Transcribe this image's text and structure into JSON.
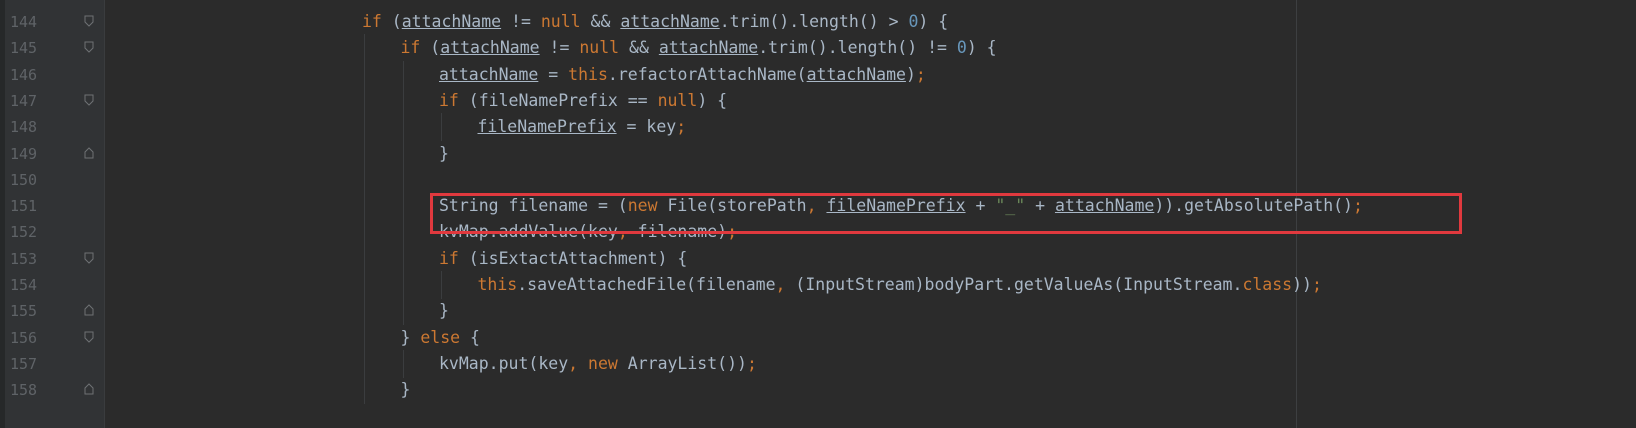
{
  "editor": {
    "lines": [
      {
        "num": "144",
        "indent": 0,
        "tokens": [
          {
            "t": "if",
            "c": "kw"
          },
          {
            "t": " ("
          },
          {
            "t": "attachName",
            "c": "ul"
          },
          {
            "t": " != "
          },
          {
            "t": "null",
            "c": "kw"
          },
          {
            "t": " && "
          },
          {
            "t": "attachName",
            "c": "ul"
          },
          {
            "t": ".trim().length() > "
          },
          {
            "t": "0",
            "c": "num"
          },
          {
            "t": ") {"
          }
        ]
      },
      {
        "num": "145",
        "indent": 1,
        "tokens": [
          {
            "t": "if",
            "c": "kw"
          },
          {
            "t": " ("
          },
          {
            "t": "attachName",
            "c": "ul"
          },
          {
            "t": " != "
          },
          {
            "t": "null",
            "c": "kw"
          },
          {
            "t": " && "
          },
          {
            "t": "attachName",
            "c": "ul"
          },
          {
            "t": ".trim().length() != "
          },
          {
            "t": "0",
            "c": "num"
          },
          {
            "t": ") {"
          }
        ]
      },
      {
        "num": "146",
        "indent": 2,
        "tokens": [
          {
            "t": "attachName",
            "c": "ul"
          },
          {
            "t": " = "
          },
          {
            "t": "this",
            "c": "kw"
          },
          {
            "t": ".refactorAttachName("
          },
          {
            "t": "attachName",
            "c": "ul"
          },
          {
            "t": ")"
          },
          {
            "t": ";",
            "c": "kw"
          }
        ]
      },
      {
        "num": "147",
        "indent": 2,
        "tokens": [
          {
            "t": "if",
            "c": "kw"
          },
          {
            "t": " (fileNamePrefix == "
          },
          {
            "t": "null",
            "c": "kw"
          },
          {
            "t": ") {"
          }
        ]
      },
      {
        "num": "148",
        "indent": 3,
        "tokens": [
          {
            "t": "fileNamePrefix",
            "c": "ul"
          },
          {
            "t": " = key"
          },
          {
            "t": ";",
            "c": "kw"
          }
        ]
      },
      {
        "num": "149",
        "indent": 2,
        "tokens": [
          {
            "t": "}"
          }
        ]
      },
      {
        "num": "150",
        "indent": 2,
        "tokens": []
      },
      {
        "num": "151",
        "indent": 2,
        "tokens": [
          {
            "t": "String filename = ("
          },
          {
            "t": "new",
            "c": "kw"
          },
          {
            "t": " File(storePath"
          },
          {
            "t": ",",
            "c": "kw"
          },
          {
            "t": " "
          },
          {
            "t": "fileNamePrefix",
            "c": "ul"
          },
          {
            "t": " + "
          },
          {
            "t": "\"_\"",
            "c": "str"
          },
          {
            "t": " + "
          },
          {
            "t": "attachName",
            "c": "ul"
          },
          {
            "t": ")).getAbsolutePath()"
          },
          {
            "t": ";",
            "c": "kw"
          }
        ]
      },
      {
        "num": "152",
        "indent": 2,
        "tokens": [
          {
            "t": "kvMap.addValue(key"
          },
          {
            "t": ",",
            "c": "kw"
          },
          {
            "t": " filename)"
          },
          {
            "t": ";",
            "c": "kw"
          }
        ]
      },
      {
        "num": "153",
        "indent": 2,
        "tokens": [
          {
            "t": "if",
            "c": "kw"
          },
          {
            "t": " (isExtactAttachment) {"
          }
        ]
      },
      {
        "num": "154",
        "indent": 3,
        "tokens": [
          {
            "t": "this",
            "c": "kw"
          },
          {
            "t": ".saveAttachedFile(filename"
          },
          {
            "t": ",",
            "c": "kw"
          },
          {
            "t": " (InputStream)bodyPart.getValueAs(InputStream."
          },
          {
            "t": "class",
            "c": "kw"
          },
          {
            "t": "))"
          },
          {
            "t": ";",
            "c": "kw"
          }
        ]
      },
      {
        "num": "155",
        "indent": 2,
        "tokens": [
          {
            "t": "}"
          }
        ]
      },
      {
        "num": "156",
        "indent": 1,
        "tokens": [
          {
            "t": "} "
          },
          {
            "t": "else",
            "c": "kw"
          },
          {
            "t": " {"
          }
        ]
      },
      {
        "num": "157",
        "indent": 2,
        "tokens": [
          {
            "t": "kvMap.put(key"
          },
          {
            "t": ",",
            "c": "kw"
          },
          {
            "t": " "
          },
          {
            "t": "new",
            "c": "kw"
          },
          {
            "t": " ArrayList())"
          },
          {
            "t": ";",
            "c": "kw"
          }
        ]
      },
      {
        "num": "158",
        "indent": 1,
        "tokens": [
          {
            "t": "}"
          }
        ]
      }
    ],
    "highlighted_line": "151"
  },
  "colors": {
    "background": "#2b2b2b",
    "keyword": "#cc7832",
    "number": "#6897bb",
    "string": "#6a8759",
    "text": "#a9b7c6",
    "highlight_box": "#e0393e"
  }
}
